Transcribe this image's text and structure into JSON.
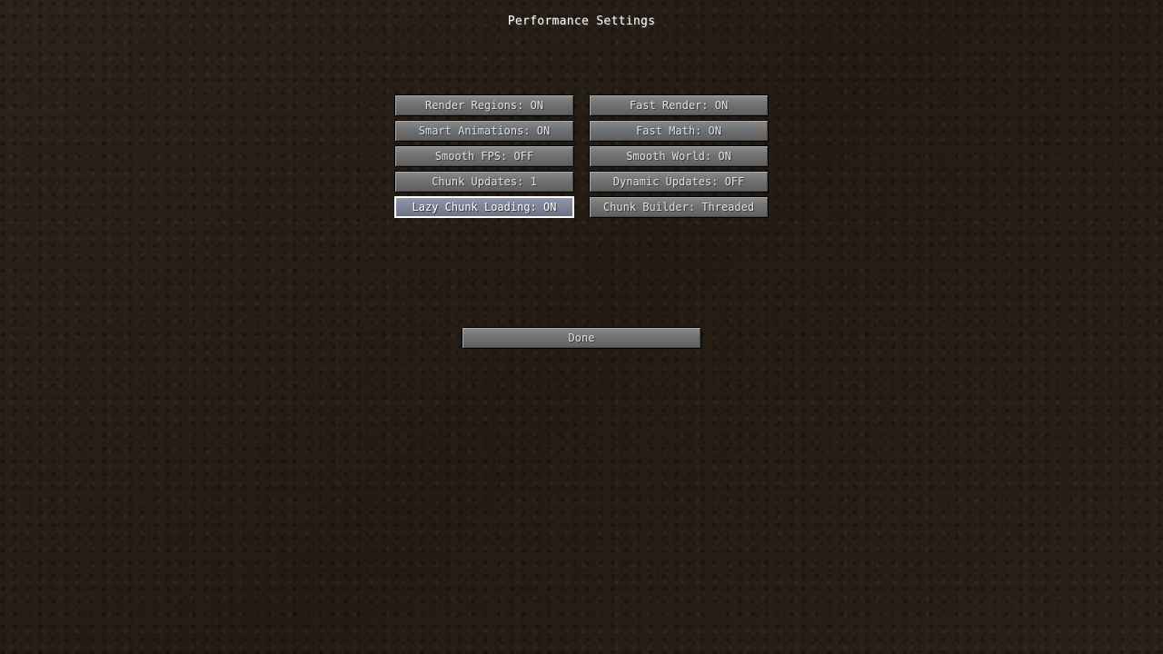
{
  "screen": {
    "title": "Performance Settings"
  },
  "options": [
    {
      "label": "Render Regions: ON",
      "name": "render-regions-button",
      "hovered": false
    },
    {
      "label": "Fast Render: ON",
      "name": "fast-render-button",
      "hovered": false
    },
    {
      "label": "Smart Animations: ON",
      "name": "smart-animations-button",
      "hovered": false
    },
    {
      "label": "Fast Math: ON",
      "name": "fast-math-button",
      "hovered": false
    },
    {
      "label": "Smooth FPS: OFF",
      "name": "smooth-fps-button",
      "hovered": false
    },
    {
      "label": "Smooth World: ON",
      "name": "smooth-world-button",
      "hovered": false
    },
    {
      "label": "Chunk Updates: 1",
      "name": "chunk-updates-button",
      "hovered": false
    },
    {
      "label": "Dynamic Updates: OFF",
      "name": "dynamic-updates-button",
      "hovered": false
    },
    {
      "label": "Lazy Chunk Loading: ON",
      "name": "lazy-chunk-loading-button",
      "hovered": true
    },
    {
      "label": "Chunk Builder: Threaded",
      "name": "chunk-builder-button",
      "hovered": false
    }
  ],
  "done_button": {
    "label": "Done"
  },
  "colors": {
    "button_text": "#e0e0e0",
    "hover_border": "#ffffff",
    "background": "#2a2018"
  }
}
